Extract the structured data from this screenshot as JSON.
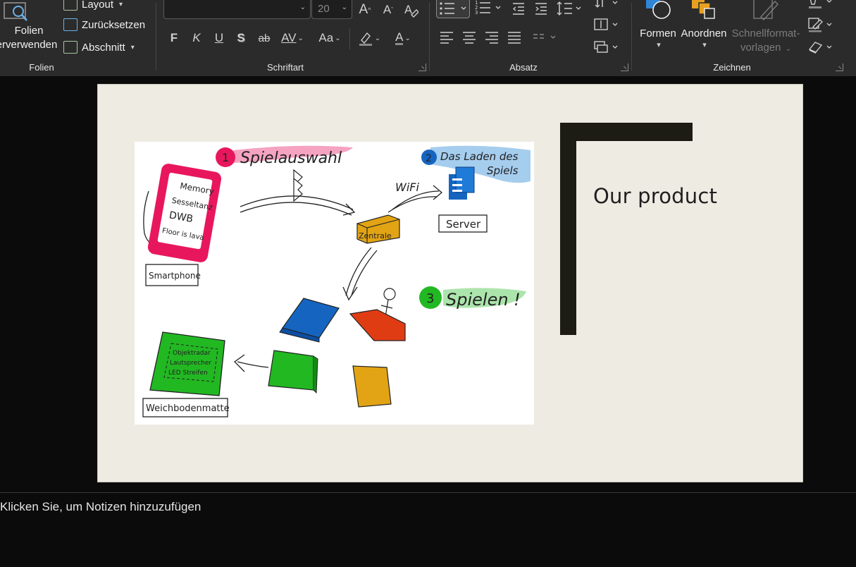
{
  "ribbon": {
    "folien": {
      "reuse_label_1": "Folien",
      "reuse_label_2": "erverwenden",
      "layout_label": "Layout",
      "reset_label": "Zurücksetzen",
      "section_label": "Abschnitt",
      "group_label": "Folien"
    },
    "schriftart": {
      "font_name": "",
      "font_size": "20",
      "bold": "F",
      "italic": "K",
      "underline": "U",
      "shadow": "S",
      "strike": "ab",
      "spacing": "AV",
      "case": "Aa",
      "grow": "A",
      "shrink": "A",
      "font_color": "A",
      "group_label": "Schriftart"
    },
    "absatz": {
      "group_label": "Absatz"
    },
    "zeichnen": {
      "shapes_label": "Formen",
      "arrange_label": "Anordnen",
      "quickstyles_label_1": "Schnellformat-",
      "quickstyles_label_2": "vorlagen",
      "group_label": "Zeichnen"
    }
  },
  "slide": {
    "title": "Our product",
    "image": {
      "step1": "Spielauswahl",
      "step1_num": "1",
      "step2_line1": "Das Laden des",
      "step2_line2": "Spiels",
      "step2_num": "2",
      "step3": "Spielen !",
      "step3_num": "3",
      "phone_items": [
        "Memory",
        "Sesseltanz",
        "DWB",
        "Floor is lava"
      ],
      "wifi": "WiFi",
      "central": "Zentrale",
      "server": "Server",
      "smartphone": "Smartphone",
      "mat_lines": [
        "Objektradar",
        "Lautsprecher",
        "LED Streifen"
      ],
      "mat_label": "Weichbodenmatte"
    }
  },
  "notes": {
    "placeholder": "Klicken Sie, um Notizen hinzuzufügen"
  },
  "colors": {
    "ribbon_bg": "#2b2b2b",
    "slide_bg": "#eeebe3",
    "frame": "#1c1c14",
    "pink": "#e8175d",
    "blue": "#1565c0",
    "green": "#22b822",
    "red": "#e03c14",
    "yellow": "#e2a414"
  }
}
